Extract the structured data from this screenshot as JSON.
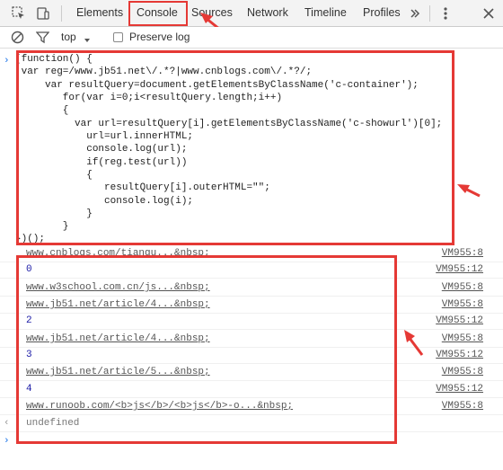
{
  "toolbar": {
    "tabs": [
      "Elements",
      "Console",
      "Sources",
      "Network",
      "Timeline",
      "Profiles"
    ],
    "menu_icon": "kebab-menu-icon",
    "close_icon": "close-icon"
  },
  "filterbar": {
    "context": "top",
    "preserve_log": "Preserve log"
  },
  "code": {
    "lines": [
      "(function() {",
      " var reg=/www.jb51.net\\/.*?|www.cnblogs.com\\/.*?/;",
      "     var resultQuery=document.getElementsByClassName('c-container');",
      "        for(var i=0;i<resultQuery.length;i++)",
      "        {",
      "          var url=resultQuery[i].getElementsByClassName('c-showurl')[0];",
      "            url=url.innerHTML;",
      "            console.log(url);",
      "            if(reg.test(url))",
      "            {",
      "               resultQuery[i].outerHTML=\"\";",
      "               console.log(i);",
      "            }",
      "        }",
      "})();"
    ]
  },
  "output": {
    "rows": [
      {
        "text": "www.cnblogs.com/tiangu...&nbsp;",
        "src": "VM955:8",
        "kind": "link"
      },
      {
        "text": "0",
        "src": "VM955:12",
        "kind": "num"
      },
      {
        "text": "www.w3school.com.cn/js...&nbsp;",
        "src": "VM955:8",
        "kind": "link"
      },
      {
        "text": "www.jb51.net/article/4...&nbsp;",
        "src": "VM955:8",
        "kind": "link"
      },
      {
        "text": "2",
        "src": "VM955:12",
        "kind": "num"
      },
      {
        "text": "www.jb51.net/article/4...&nbsp;",
        "src": "VM955:8",
        "kind": "link"
      },
      {
        "text": "3",
        "src": "VM955:12",
        "kind": "num"
      },
      {
        "text": "www.jb51.net/article/5...&nbsp;",
        "src": "VM955:8",
        "kind": "link"
      },
      {
        "text": "4",
        "src": "VM955:12",
        "kind": "num"
      },
      {
        "text": "www.runoob.com/<b>js</b>/<b>js</b>-o...&nbsp;",
        "src": "VM955:8",
        "kind": "link"
      }
    ],
    "result": "undefined"
  },
  "colors": {
    "annotation": "#e53935",
    "link_blue": "#1a1aa6"
  }
}
